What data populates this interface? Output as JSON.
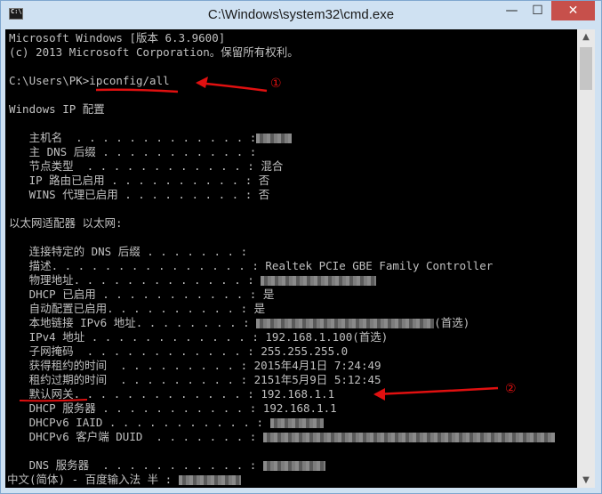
{
  "window": {
    "title": "C:\\Windows\\system32\\cmd.exe",
    "btn_min": "—",
    "btn_max": "☐",
    "btn_close": "✕"
  },
  "console": {
    "header_line1": "Microsoft Windows [版本 6.3.9600]",
    "header_line2": "(c) 2013 Microsoft Corporation。保留所有权利。",
    "prompt": "C:\\Users\\PK>ipconfig/all",
    "windows_ip_title": "Windows IP 配置",
    "host": {
      "label": "   主机名  . . . . . . . . . . . . . :"
    },
    "dns_suffix": {
      "label": "   主 DNS 后缀 . . . . . . . . . . . :"
    },
    "node_type": {
      "label": "   节点类型  . . . . . . . . . . . . :",
      "value": "混合"
    },
    "ip_routing": {
      "label": "   IP 路由已启用 . . . . . . . . . . :",
      "value": "否"
    },
    "wins_proxy": {
      "label": "   WINS 代理已启用 . . . . . . . . . :",
      "value": "否"
    },
    "adapter_title": "以太网适配器 以太网:",
    "conn_dns": {
      "label": "   连接特定的 DNS 后缀 . . . . . . . :"
    },
    "description": {
      "label": "   描述. . . . . . . . . . . . . . . :",
      "value": "Realtek PCIe GBE Family Controller"
    },
    "physical": {
      "label": "   物理地址. . . . . . . . . . . . . :"
    },
    "dhcp_enabled": {
      "label": "   DHCP 已启用 . . . . . . . . . . . :",
      "value": "是"
    },
    "autoconfig": {
      "label": "   自动配置已启用. . . . . . . . . . :",
      "value": "是"
    },
    "ipv6": {
      "label": "   本地链接 IPv6 地址. . . . . . . . :",
      "value": "(首选)"
    },
    "ipv4": {
      "label": "   IPv4 地址 . . . . . . . . . . . . :",
      "value": "192.168.1.100(首选)"
    },
    "subnet": {
      "label": "   子网掩码  . . . . . . . . . . . . :",
      "value": "255.255.255.0"
    },
    "lease_obtained": {
      "label": "   获得租约的时间  . . . . . . . . . :",
      "value": "2015年4月1日 7:24:49"
    },
    "lease_expires": {
      "label": "   租约过期的时间  . . . . . . . . . :",
      "value": "2151年5月9日 5:12:45"
    },
    "gateway": {
      "label": "   默认网关. . . . . . . . . . . . . :",
      "value": "192.168.1.1"
    },
    "dhcp_server": {
      "label": "   DHCP 服务器 . . . . . . . . . . . :",
      "value": "192.168.1.1"
    },
    "dhcpv6_iaid": {
      "label": "   DHCPv6 IAID . . . . . . . . . . . :"
    },
    "dhcpv6_duid": {
      "label": "   DHCPv6 客户端 DUID  . . . . . . . :"
    },
    "dns_servers": {
      "label": "   DNS 服务器  . . . . . . . . . . . :"
    },
    "ime_status": "中文(简体) - 百度输入法 半 :"
  },
  "annotations": {
    "marker1": "①",
    "marker2": "②"
  },
  "colors": {
    "console_bg": "#000000",
    "console_text": "#c0c0c0",
    "annotation": "#e01010",
    "close_button": "#c7504b"
  }
}
